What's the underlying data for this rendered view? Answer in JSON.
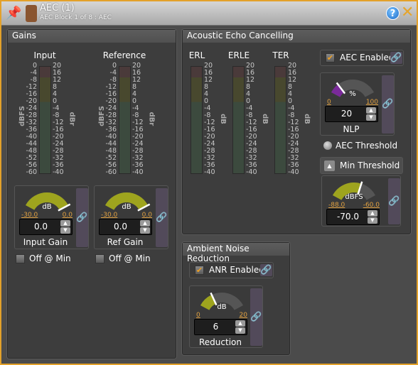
{
  "window": {
    "title": "AEC (1)",
    "subtitle": "AEC Block 1 of 8 : AEC",
    "help_icon": "help-icon",
    "close_icon": "close-icon"
  },
  "colors": {
    "border": "#e3a12a",
    "gain_arc": "#9ea41e",
    "nlp_arc": "#7a2a9a",
    "range_text": "#e0a040"
  },
  "gains": {
    "header": "Gains",
    "meters": [
      {
        "title": "Input",
        "left_unit": "dBFS",
        "right_unit": "dBr"
      },
      {
        "title": "Reference",
        "left_unit": "dBFS",
        "right_unit": "dBr"
      }
    ],
    "left_scale": [
      "0",
      "-4",
      "-8",
      "-12",
      "-16",
      "-20",
      "-24",
      "-28",
      "-32",
      "-36",
      "-40",
      "-44",
      "-48",
      "-52",
      "-56",
      "-60"
    ],
    "right_scale": [
      "20",
      "16",
      "12",
      "8",
      "4",
      "0",
      "-4",
      "-8",
      "-12",
      "-16",
      "-20",
      "-24",
      "-28",
      "-32",
      "-36",
      "-40"
    ],
    "knobs": [
      {
        "label": "Input Gain",
        "unit": "dB",
        "min": "-30.0",
        "max": "0.0",
        "value": "0.0"
      },
      {
        "label": "Ref Gain",
        "unit": "dB",
        "min": "-30.0",
        "max": "0.0",
        "value": "0.0"
      }
    ],
    "off_at_min": [
      {
        "label": "Off @ Min",
        "checked": false
      },
      {
        "label": "Off @ Min",
        "checked": false
      }
    ]
  },
  "aec": {
    "header": "Acoustic Echo Cancelling",
    "meters": [
      {
        "title": "ERL",
        "unit": "dB"
      },
      {
        "title": "ERLE",
        "unit": "dB"
      },
      {
        "title": "TER",
        "unit": "dB"
      }
    ],
    "scale": [
      "20",
      "16",
      "12",
      "8",
      "4",
      "0",
      "-4",
      "-8",
      "-12",
      "-16",
      "-20",
      "-24",
      "-28",
      "-32",
      "-36",
      "-40"
    ],
    "enabled": {
      "label": "AEC Enabled",
      "checked": true
    },
    "nlp": {
      "label": "NLP",
      "unit": "%",
      "min": "0",
      "max": "100",
      "value": "20"
    },
    "threshold_indicator": "AEC Threshold",
    "min_threshold_button": "Min Threshold",
    "min_threshold": {
      "unit": "dBFS",
      "min": "-88.0",
      "max": "-60.0",
      "value": "-70.0"
    }
  },
  "anr": {
    "header": "Ambient Noise Reduction",
    "enabled": {
      "label": "ANR Enabled",
      "checked": true
    },
    "reduction": {
      "label": "Reduction",
      "unit": "dB",
      "min": "0",
      "max": "20",
      "value": "6"
    }
  }
}
